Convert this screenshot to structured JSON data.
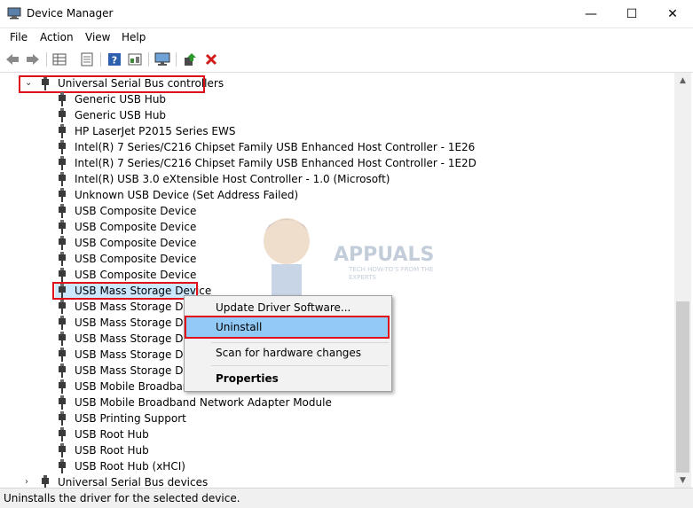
{
  "window": {
    "title": "Device Manager",
    "controls": {
      "minimize": "—",
      "maximize": "☐",
      "close": "✕"
    }
  },
  "menu": [
    "File",
    "Action",
    "View",
    "Help"
  ],
  "toolbar": {
    "icons": [
      "back-arrow-icon",
      "forward-arrow-icon",
      "properties-grid-icon",
      "list-view-icon",
      "help-icon",
      "show-hidden-icon",
      "monitor-icon",
      "update-driver-icon",
      "uninstall-x-icon"
    ]
  },
  "tree": {
    "category": "Universal Serial Bus controllers",
    "items": [
      "Generic USB Hub",
      "Generic USB Hub",
      "HP LaserJet P2015 Series EWS",
      "Intel(R) 7 Series/C216 Chipset Family USB Enhanced Host Controller - 1E26",
      "Intel(R) 7 Series/C216 Chipset Family USB Enhanced Host Controller - 1E2D",
      "Intel(R) USB 3.0 eXtensible Host Controller - 1.0 (Microsoft)",
      "Unknown USB Device (Set Address Failed)",
      "USB Composite Device",
      "USB Composite Device",
      "USB Composite Device",
      "USB Composite Device",
      "USB Composite Device",
      "USB Mass Storage Device",
      "USB Mass Storage Devic",
      "USB Mass Storage Devic",
      "USB Mass Storage Devic",
      "USB Mass Storage Devic",
      "USB Mass Storage Devic",
      "USB Mobile Broadband",
      "USB Mobile Broadband Network Adapter Module",
      "USB Printing Support",
      "USB Root Hub",
      "USB Root Hub",
      "USB Root Hub (xHCI)"
    ],
    "next_category": "Universal Serial Bus devices"
  },
  "context_menu": {
    "items": [
      "Update Driver Software...",
      "Uninstall",
      "Scan for hardware changes",
      "Properties"
    ]
  },
  "watermark": {
    "text": "APPUALS",
    "subtext": "TECH HOW-TO'S FROM THE EXPERTS"
  },
  "status": {
    "text": "Uninstalls the driver for the selected device."
  },
  "colors": {
    "highlight": "#e0101a",
    "selection": "#cce8ff",
    "menu_hover": "#91c9f7"
  }
}
